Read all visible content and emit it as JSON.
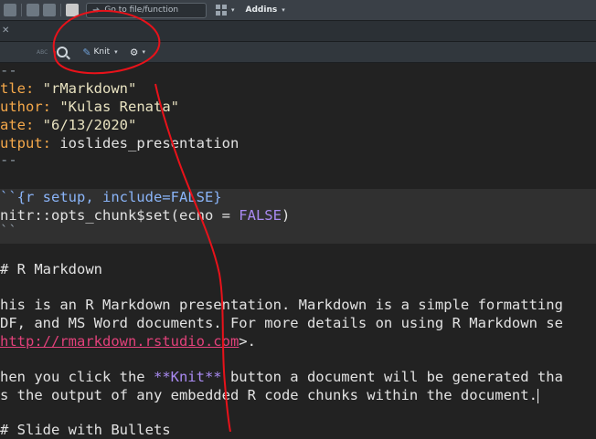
{
  "main_toolbar": {
    "goto_placeholder": "Go to file/function",
    "addins_label": "Addins",
    "addins_caret": "▾",
    "grid_caret": "▾"
  },
  "tab_bar": {
    "close_glyph": "✕"
  },
  "editor_toolbar": {
    "spell_label": "ABC",
    "knit_label": "Knit",
    "knit_caret": "▾",
    "gear_glyph": "⚙",
    "gear_caret": "▾"
  },
  "editor": {
    "yaml_open": "--",
    "title_key": "tle:",
    "title_val": " \"rMarkdown\"",
    "author_key": "uthor:",
    "author_val": " \"Kulas Renata\"",
    "date_key": "ate:",
    "date_val": " \"6/13/2020\"",
    "output_key": "utput:",
    "output_val": " ioslides_presentation",
    "yaml_close": "--",
    "chunk_header": "``{r setup, include=FALSE}",
    "chunk_code_a": "nitr::opts_chunk$set(echo = ",
    "chunk_code_false": "FALSE",
    "chunk_code_b": ")",
    "chunk_close": "``",
    "heading": "# R Markdown",
    "para1_line1": "his is an R Markdown presentation. Markdown is a simple formatting",
    "para1_line2": "DF, and MS Word documents. For more details on using R Markdown se",
    "para1_link": "http://rmarkdown.rstudio.com",
    "para1_link_after": ">.",
    "para2_line1_a": "hen you click the ",
    "para2_bold": "**Knit**",
    "para2_line1_b": " button a document will be generated tha",
    "para2_line2": "s the output of any embedded R code chunks within the document.",
    "heading2": "# Slide with Bullets"
  },
  "colors": {
    "annotation_red": "#e8121a",
    "background": "#222222"
  }
}
